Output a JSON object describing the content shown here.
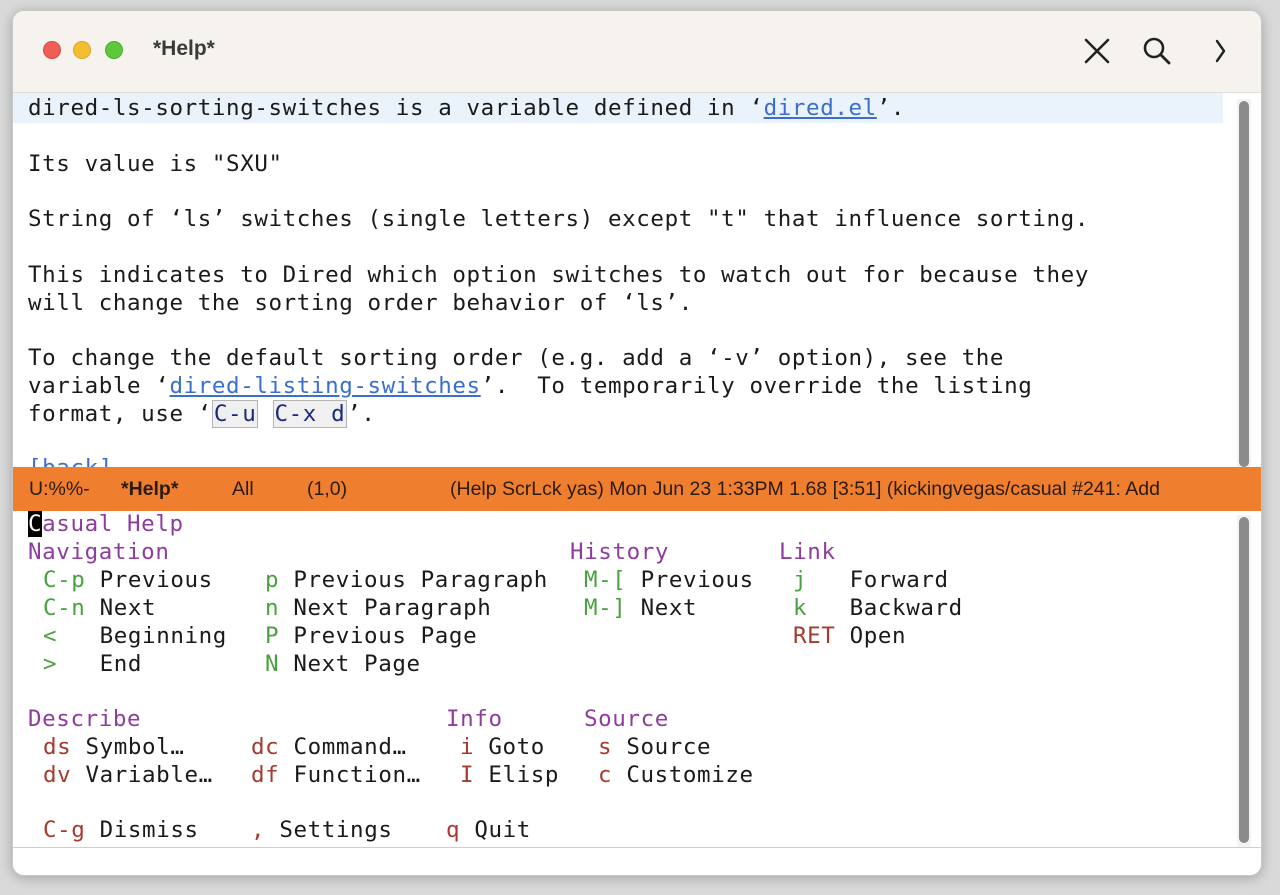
{
  "window": {
    "title": "*Help*"
  },
  "help_buffer": {
    "line1_pre": "dired-ls-sorting-switches is a variable defined in ‘",
    "line1_link": "dired.el",
    "line1_post": "’.",
    "line2": "Its value is \"SXU\"",
    "line3": "String of ‘ls’ switches (single letters) except \"t\" that influence sorting.",
    "line4": "This indicates to Dired which option switches to watch out for because they",
    "line5": "will change the sorting order behavior of ‘ls’.",
    "line6": "To change the default sorting order (e.g. add a ‘-v’ option), see the",
    "line7_pre": "variable ‘",
    "line7_link": "dired-listing-switches",
    "line7_post": "’.  To temporarily override the listing",
    "line8_pre": "format, use ‘",
    "line8_key1": "C-u",
    "line8_key2": "C-x d",
    "line8_post": "’.",
    "back_link": "[back]"
  },
  "modeline": {
    "state": "U:%%-",
    "buffer": "*Help*",
    "position": "All",
    "coords": "(1,0)",
    "info": "(Help ScrLck yas) Mon Jun 23 1:33PM 1.68 [3:51] (kickingvegas/casual #241: Add"
  },
  "casual_menu": {
    "cursor_char": "C",
    "title_rest": "asual Help",
    "groups": {
      "navigation": "Navigation",
      "history": "History",
      "link": "Link",
      "describe": "Describe",
      "info": "Info",
      "source": "Source"
    },
    "nav": [
      {
        "key": "C-p",
        "label": "Previous"
      },
      {
        "key": "C-n",
        "label": "Next"
      },
      {
        "key": "<",
        "label": "Beginning"
      },
      {
        "key": ">",
        "label": "End"
      }
    ],
    "para": [
      {
        "key": "p",
        "label": "Previous Paragraph"
      },
      {
        "key": "n",
        "label": "Next Paragraph"
      },
      {
        "key": "P",
        "label": "Previous Page"
      },
      {
        "key": "N",
        "label": "Next Page"
      }
    ],
    "history": [
      {
        "key": "M-[",
        "label": "Previous"
      },
      {
        "key": "M-]",
        "label": "Next"
      }
    ],
    "link": [
      {
        "key": "j",
        "label": "Forward"
      },
      {
        "key": "k",
        "label": "Backward"
      },
      {
        "key": "RET",
        "label": "Open"
      }
    ],
    "describe_a": [
      {
        "key": "ds",
        "label": "Symbol…"
      },
      {
        "key": "dv",
        "label": "Variable…"
      }
    ],
    "describe_b": [
      {
        "key": "dc",
        "label": "Command…"
      },
      {
        "key": "df",
        "label": "Function…"
      }
    ],
    "info": [
      {
        "key": "i",
        "label": "Goto"
      },
      {
        "key": "I",
        "label": "Elisp"
      }
    ],
    "source": [
      {
        "key": "s",
        "label": "Source"
      },
      {
        "key": "c",
        "label": "Customize"
      }
    ],
    "footer": [
      {
        "key": "C-g",
        "label": "Dismiss"
      },
      {
        "key": ",",
        "label": "Settings"
      },
      {
        "key": "q",
        "label": "Quit"
      }
    ]
  },
  "colors": {
    "modeline_bg": "#ef7f2e",
    "group_heading": "#8e3d9e",
    "nav_key": "#4aa13f",
    "action_key": "#a43b2e",
    "link": "#3a6fd0"
  },
  "icons": {
    "close": "close-icon",
    "search": "search-icon",
    "more": "chevron-right-icon"
  }
}
